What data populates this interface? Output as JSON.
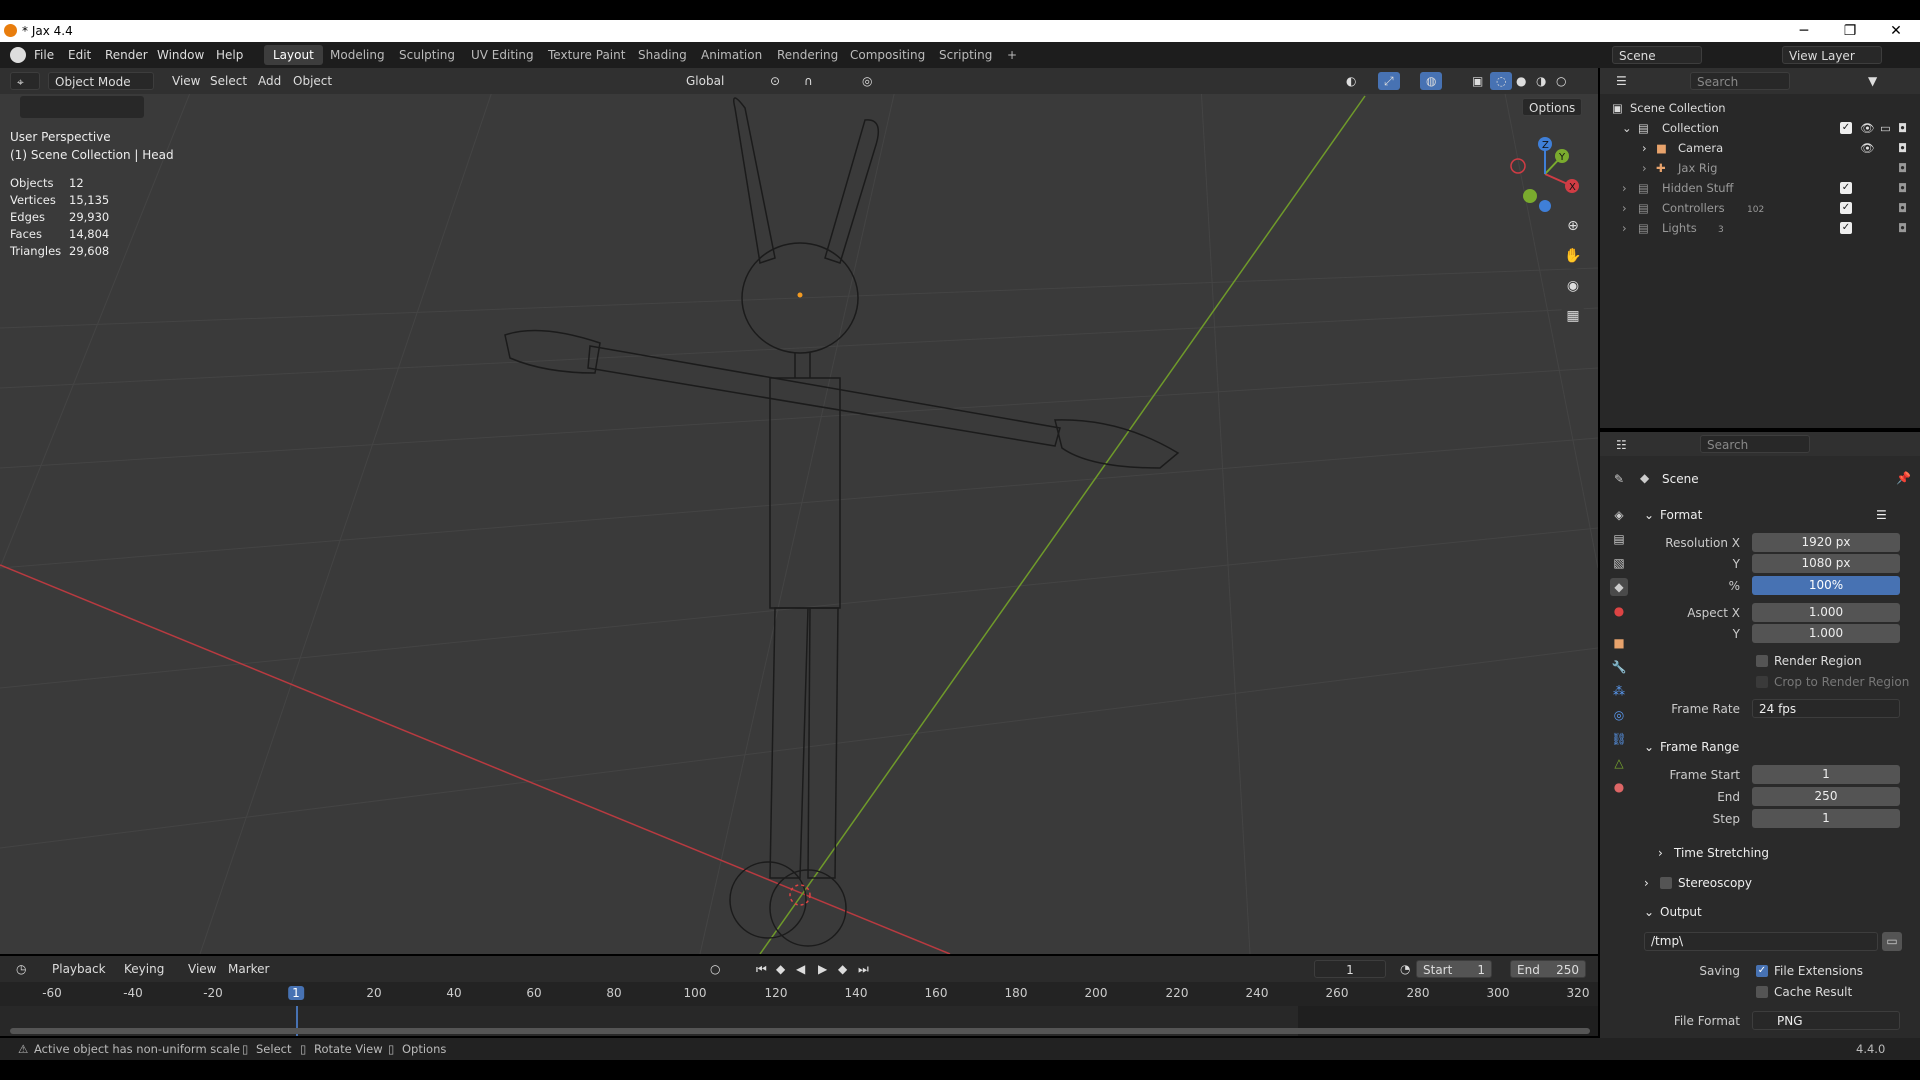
{
  "window": {
    "title": "* Jax 4.4",
    "minimize": "─",
    "maximize": "❐",
    "close": "✕"
  },
  "menu": {
    "items": [
      "File",
      "Edit",
      "Render",
      "Window",
      "Help"
    ]
  },
  "workspaces": [
    "Layout",
    "Modeling",
    "Sculpting",
    "UV Editing",
    "Texture Paint",
    "Shading",
    "Animation",
    "Rendering",
    "Compositing",
    "Scripting"
  ],
  "add_workspace": "+",
  "scene_selector": {
    "scene": "Scene",
    "view_layer": "View Layer"
  },
  "viewport_header": {
    "mode": "Object Mode",
    "menus": [
      "View",
      "Select",
      "Add",
      "Object"
    ],
    "orientation": "Global",
    "options": "Options"
  },
  "overlay_text": {
    "perspective": "User Perspective",
    "collection": "(1) Scene Collection | Head"
  },
  "stats": [
    {
      "label": "Objects",
      "value": "12"
    },
    {
      "label": "Vertices",
      "value": "15,135"
    },
    {
      "label": "Edges",
      "value": "29,930"
    },
    {
      "label": "Faces",
      "value": "14,804"
    },
    {
      "label": "Triangles",
      "value": "29,608"
    }
  ],
  "gizmo": {
    "x": "X",
    "y": "Y",
    "z": "Z"
  },
  "outliner": {
    "search_placeholder": "Search",
    "root": "Scene Collection",
    "rows": [
      {
        "name": "Collection"
      },
      {
        "name": "Camera"
      },
      {
        "name": "Jax Rig"
      },
      {
        "name": "Hidden Stuff"
      },
      {
        "name": "Controllers",
        "badge": "102"
      },
      {
        "name": "Lights",
        "badge": "3"
      }
    ]
  },
  "properties": {
    "search_placeholder": "Search",
    "context": "Scene",
    "format": {
      "title": "Format",
      "resolution_x_label": "Resolution X",
      "resolution_x": "1920 px",
      "resolution_y_label": "Y",
      "resolution_y": "1080 px",
      "percent_label": "%",
      "percent": "100%",
      "aspect_x_label": "Aspect X",
      "aspect_x": "1.000",
      "aspect_y_label": "Y",
      "aspect_y": "1.000",
      "render_region": "Render Region",
      "crop_region": "Crop to Render Region",
      "frame_rate_label": "Frame Rate",
      "frame_rate": "24 fps"
    },
    "frame_range": {
      "title": "Frame Range",
      "start_label": "Frame Start",
      "start": "1",
      "end_label": "End",
      "end": "250",
      "step_label": "Step",
      "step": "1",
      "time_stretching": "Time Stretching"
    },
    "stereoscopy": "Stereoscopy",
    "output": {
      "title": "Output",
      "path": "/tmp\\",
      "saving_label": "Saving",
      "file_extensions": "File Extensions",
      "cache_result": "Cache Result",
      "file_format_label": "File Format",
      "file_format": "PNG"
    }
  },
  "timeline": {
    "menus": [
      "Playback",
      "Keying",
      "View",
      "Marker"
    ],
    "current_frame": "1",
    "start_label": "Start",
    "start": "1",
    "end_label": "End",
    "end": "250",
    "ticks": [
      "-60",
      "-40",
      "-20",
      "1",
      "20",
      "40",
      "60",
      "80",
      "100",
      "120",
      "140",
      "160",
      "180",
      "200",
      "220",
      "240",
      "260",
      "280",
      "300",
      "320"
    ]
  },
  "status": {
    "warning": "Active object has non-uniform scale",
    "select": "Select",
    "rotate": "Rotate View",
    "options": "Options",
    "version": "4.4.0"
  },
  "colors": {
    "accent": "#4772b3",
    "x_axis": "#d03c44",
    "y_axis": "#7aab2e",
    "z_axis": "#3f7fd8",
    "frame_indicator": "#4772b3"
  }
}
